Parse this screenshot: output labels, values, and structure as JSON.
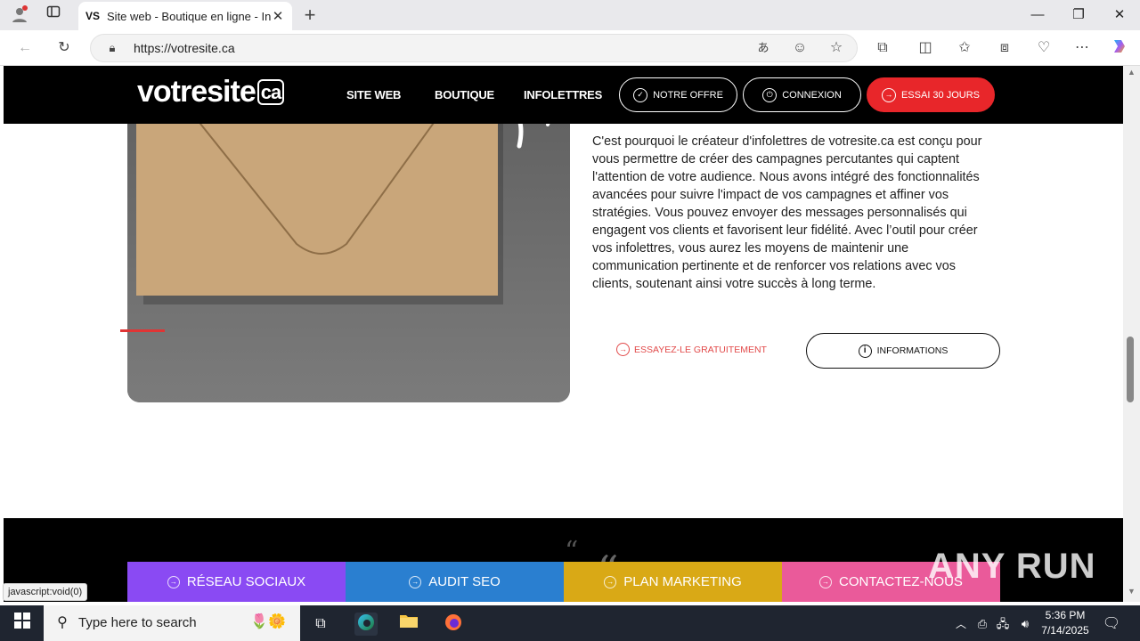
{
  "browser": {
    "tab_title": "Site web - Boutique en ligne - Info",
    "tab_favicon": "VS",
    "url": "https://votresite.ca",
    "status_url": "javascript:void(0)"
  },
  "site": {
    "logo_text": "votresite",
    "logo_suffix": "ca",
    "nav": [
      "SITE WEB",
      "BOUTIQUE",
      "INFOLETTRES"
    ],
    "btn_offre": "NOTRE OFFRE",
    "btn_connexion": "CONNEXION",
    "btn_essai": "ESSAI 30 JOURS",
    "body_text": "C'est pourquoi le créateur d'infolettres de votresite.ca est conçu pour vous permettre de créer des campagnes percutantes qui captent l'attention de votre audience. Nous avons intégré des fonctionnalités avancées pour suivre l'impact de vos campagnes et affiner vos stratégies. Vous pouvez envoyer des messages personnalisés qui engagent vos clients et favorisent leur fidélité. Avec l’outil pour créer vos infolettres, vous aurez les moyens de maintenir une communication pertinente et de renforcer vos relations avec vos clients, soutenant ainsi votre succès à long terme.",
    "try_link": "ESSAYEZ-LE GRATUITEMENT",
    "info_btn": "INFORMATIONS",
    "quote_glyph": "“",
    "footer_buttons": [
      {
        "label": "RÉSEAU SOCIAUX",
        "color": "#8a4af3"
      },
      {
        "label": "AUDIT SEO",
        "color": "#2a7fd0"
      },
      {
        "label": "PLAN MARKETING",
        "color": "#d9a916"
      },
      {
        "label": "CONTACTEZ-NOUS",
        "color": "#ea5a9a"
      }
    ],
    "accent_red": "#e8262a"
  },
  "watermark": "ANY RUN",
  "taskbar": {
    "search_placeholder": "Type here to search",
    "time": "5:36 PM",
    "date": "7/14/2025"
  }
}
